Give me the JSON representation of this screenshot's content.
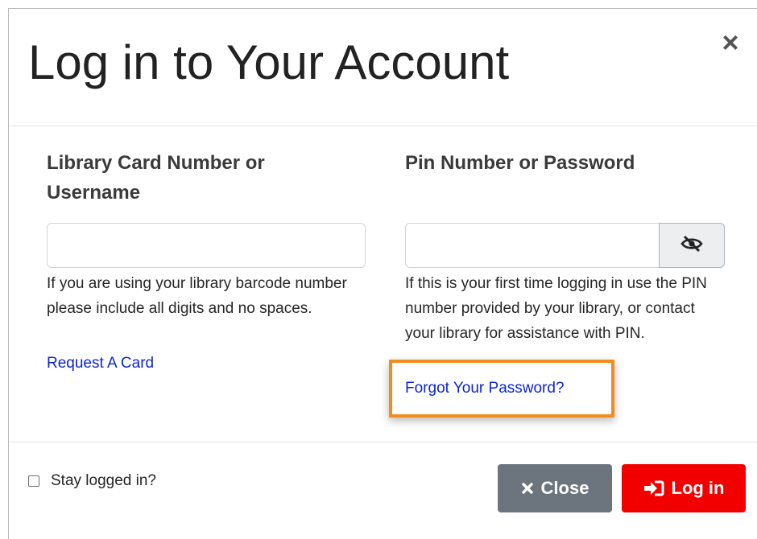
{
  "modal": {
    "title": "Log in to Your Account",
    "close_glyph": "×"
  },
  "username_field": {
    "label": "Library Card Number or Username",
    "value": "",
    "placeholder": "",
    "help_text": "If you are using your library barcode number please include all digits and no spaces.",
    "request_card_link": "Request A Card"
  },
  "password_field": {
    "label": "Pin Number or Password",
    "value": "",
    "placeholder": "",
    "visibility_icon": "eye-slash-icon",
    "help_text": "If this is your first time logging in use the PIN number provided by your library, or contact your library for assistance with PIN.",
    "forgot_password_link": "Forgot Your Password?"
  },
  "footer": {
    "stay_logged_in_label": "Stay logged in?",
    "stay_logged_in_checked": false,
    "close_button_label": "Close",
    "close_button_icon": "times-icon",
    "login_button_label": "Log in",
    "login_button_icon": "sign-in-icon"
  },
  "colors": {
    "link": "#0b24d6",
    "login_button": "#f20000",
    "close_button": "#6c757d",
    "highlight": "#f28c1e"
  }
}
